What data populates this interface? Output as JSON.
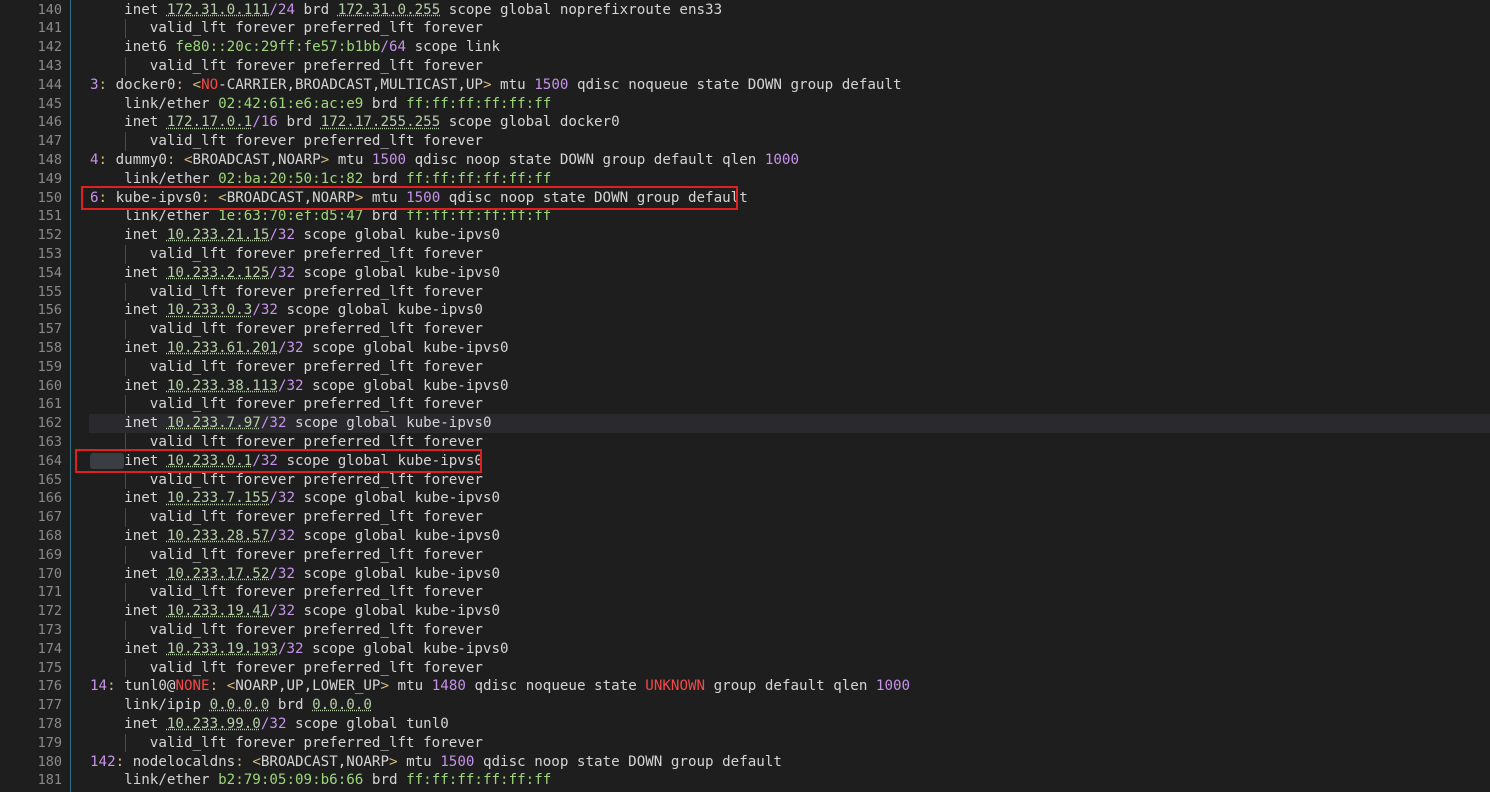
{
  "editor": {
    "line_numbers": [
      140,
      141,
      142,
      143,
      144,
      145,
      146,
      147,
      148,
      149,
      150,
      151,
      152,
      153,
      154,
      155,
      156,
      157,
      158,
      159,
      160,
      161,
      162,
      163,
      164,
      165,
      166,
      167,
      168,
      169,
      170,
      171,
      172,
      173,
      174,
      175,
      176,
      177,
      178,
      179,
      180,
      181
    ],
    "current_line": 162,
    "lines": [
      {
        "indent": 2,
        "tokens": [
          [
            "p",
            "inet "
          ],
          [
            "ip",
            "172.31.0.111"
          ],
          [
            "s",
            "/24"
          ],
          [
            "p",
            " brd "
          ],
          [
            "ip",
            "172.31.0.255"
          ],
          [
            "p",
            " scope global noprefixroute ens33"
          ]
        ]
      },
      {
        "indent": 3,
        "tokens": [
          [
            "p",
            "valid_lft forever preferred_lft forever"
          ]
        ]
      },
      {
        "indent": 2,
        "tokens": [
          [
            "p",
            "inet6 "
          ],
          [
            "mac",
            "fe80::20c:29ff:fe57:b1bb"
          ],
          [
            "s",
            "/64"
          ],
          [
            "p",
            " scope link"
          ]
        ]
      },
      {
        "indent": 3,
        "tokens": [
          [
            "p",
            "valid_lft forever preferred_lft forever"
          ]
        ]
      },
      {
        "indent": 0,
        "tokens": [
          [
            "idx",
            "3"
          ],
          [
            "c",
            ":"
          ],
          [
            "p",
            " docker0"
          ],
          [
            "c",
            ":"
          ],
          [
            "p",
            " "
          ],
          [
            "a",
            "<"
          ],
          [
            "r",
            "NO"
          ],
          [
            "p",
            "-CARRIER,BROADCAST,MULTICAST,UP"
          ],
          [
            "a",
            ">"
          ],
          [
            "p",
            " mtu "
          ],
          [
            "n",
            "1500"
          ],
          [
            "p",
            " qdisc noqueue state DOWN group default"
          ]
        ]
      },
      {
        "indent": 2,
        "tokens": [
          [
            "p",
            "link/ether "
          ],
          [
            "mac2",
            "02:42:61:e6:ac:e9"
          ],
          [
            "p",
            " brd "
          ],
          [
            "mac",
            "ff:ff:ff:ff:ff:ff"
          ]
        ]
      },
      {
        "indent": 2,
        "tokens": [
          [
            "p",
            "inet "
          ],
          [
            "ip",
            "172.17.0.1"
          ],
          [
            "s",
            "/16"
          ],
          [
            "p",
            " brd "
          ],
          [
            "ip",
            "172.17.255.255"
          ],
          [
            "p",
            " scope global docker0"
          ]
        ]
      },
      {
        "indent": 3,
        "tokens": [
          [
            "p",
            "valid_lft forever preferred_lft forever"
          ]
        ]
      },
      {
        "indent": 0,
        "tokens": [
          [
            "idx",
            "4"
          ],
          [
            "c",
            ":"
          ],
          [
            "p",
            " dummy0"
          ],
          [
            "c",
            ":"
          ],
          [
            "p",
            " "
          ],
          [
            "a",
            "<"
          ],
          [
            "p",
            "BROADCAST,NOARP"
          ],
          [
            "a",
            ">"
          ],
          [
            "p",
            " mtu "
          ],
          [
            "n",
            "1500"
          ],
          [
            "p",
            " qdisc noop state DOWN group default qlen "
          ],
          [
            "n",
            "1000"
          ]
        ]
      },
      {
        "indent": 2,
        "tokens": [
          [
            "p",
            "link/ether "
          ],
          [
            "mac",
            "02:ba:20:50:1c:82"
          ],
          [
            "p",
            " brd "
          ],
          [
            "mac",
            "ff:ff:ff:ff:ff:ff"
          ]
        ]
      },
      {
        "indent": 0,
        "tokens": [
          [
            "idx",
            "6"
          ],
          [
            "c",
            ":"
          ],
          [
            "p",
            " kube-ipvs0"
          ],
          [
            "c",
            ":"
          ],
          [
            "p",
            " "
          ],
          [
            "a",
            "<"
          ],
          [
            "p",
            "BROADCAST,NOARP"
          ],
          [
            "a",
            ">"
          ],
          [
            "p",
            " mtu "
          ],
          [
            "n",
            "1500"
          ],
          [
            "p",
            " qdisc noop state DOWN group default"
          ]
        ]
      },
      {
        "indent": 2,
        "tokens": [
          [
            "p",
            "link/ether "
          ],
          [
            "mac2",
            "1e:63:70:ef:d5:47"
          ],
          [
            "p",
            " brd "
          ],
          [
            "mac",
            "ff:ff:ff:ff:ff:ff"
          ]
        ]
      },
      {
        "indent": 2,
        "tokens": [
          [
            "p",
            "inet "
          ],
          [
            "ip",
            "10.233.21.15"
          ],
          [
            "s",
            "/32"
          ],
          [
            "p",
            " scope global kube-ipvs0"
          ]
        ]
      },
      {
        "indent": 3,
        "tokens": [
          [
            "p",
            "valid_lft forever preferred_lft forever"
          ]
        ]
      },
      {
        "indent": 2,
        "tokens": [
          [
            "p",
            "inet "
          ],
          [
            "ip",
            "10.233.2.125"
          ],
          [
            "s",
            "/32"
          ],
          [
            "p",
            " scope global kube-ipvs0"
          ]
        ]
      },
      {
        "indent": 3,
        "tokens": [
          [
            "p",
            "valid_lft forever preferred_lft forever"
          ]
        ]
      },
      {
        "indent": 2,
        "tokens": [
          [
            "p",
            "inet "
          ],
          [
            "ip",
            "10.233.0.3"
          ],
          [
            "s",
            "/32"
          ],
          [
            "p",
            " scope global kube-ipvs0"
          ]
        ]
      },
      {
        "indent": 3,
        "tokens": [
          [
            "p",
            "valid_lft forever preferred_lft forever"
          ]
        ]
      },
      {
        "indent": 2,
        "tokens": [
          [
            "p",
            "inet "
          ],
          [
            "ip",
            "10.233.61.201"
          ],
          [
            "s",
            "/32"
          ],
          [
            "p",
            " scope global kube-ipvs0"
          ]
        ]
      },
      {
        "indent": 3,
        "tokens": [
          [
            "p",
            "valid_lft forever preferred_lft forever"
          ]
        ]
      },
      {
        "indent": 2,
        "tokens": [
          [
            "p",
            "inet "
          ],
          [
            "ip",
            "10.233.38.113"
          ],
          [
            "s",
            "/32"
          ],
          [
            "p",
            " scope global kube-ipvs0"
          ]
        ]
      },
      {
        "indent": 3,
        "tokens": [
          [
            "p",
            "valid_lft forever preferred_lft forever"
          ]
        ]
      },
      {
        "indent": 2,
        "tokens": [
          [
            "p",
            "inet "
          ],
          [
            "ip",
            "10.233.7.97"
          ],
          [
            "s",
            "/32"
          ],
          [
            "p",
            " scope global kube-ipvs0"
          ]
        ]
      },
      {
        "indent": 3,
        "tokens": [
          [
            "p",
            "valid_lft forever preferred_lft forever"
          ]
        ]
      },
      {
        "indent": 2,
        "tokens": [
          [
            "p",
            "inet "
          ],
          [
            "ip",
            "10.233.0.1"
          ],
          [
            "s",
            "/32"
          ],
          [
            "p",
            " scope global kube-ipvs0"
          ]
        ],
        "selected": true
      },
      {
        "indent": 3,
        "tokens": [
          [
            "p",
            "valid_lft forever preferred_lft forever"
          ]
        ]
      },
      {
        "indent": 2,
        "tokens": [
          [
            "p",
            "inet "
          ],
          [
            "ip",
            "10.233.7.155"
          ],
          [
            "s",
            "/32"
          ],
          [
            "p",
            " scope global kube-ipvs0"
          ]
        ]
      },
      {
        "indent": 3,
        "tokens": [
          [
            "p",
            "valid_lft forever preferred_lft forever"
          ]
        ]
      },
      {
        "indent": 2,
        "tokens": [
          [
            "p",
            "inet "
          ],
          [
            "ip",
            "10.233.28.57"
          ],
          [
            "s",
            "/32"
          ],
          [
            "p",
            " scope global kube-ipvs0"
          ]
        ]
      },
      {
        "indent": 3,
        "tokens": [
          [
            "p",
            "valid_lft forever preferred_lft forever"
          ]
        ]
      },
      {
        "indent": 2,
        "tokens": [
          [
            "p",
            "inet "
          ],
          [
            "ip",
            "10.233.17.52"
          ],
          [
            "s",
            "/32"
          ],
          [
            "p",
            " scope global kube-ipvs0"
          ]
        ]
      },
      {
        "indent": 3,
        "tokens": [
          [
            "p",
            "valid_lft forever preferred_lft forever"
          ]
        ]
      },
      {
        "indent": 2,
        "tokens": [
          [
            "p",
            "inet "
          ],
          [
            "ip",
            "10.233.19.41"
          ],
          [
            "s",
            "/32"
          ],
          [
            "p",
            " scope global kube-ipvs0"
          ]
        ]
      },
      {
        "indent": 3,
        "tokens": [
          [
            "p",
            "valid_lft forever preferred_lft forever"
          ]
        ]
      },
      {
        "indent": 2,
        "tokens": [
          [
            "p",
            "inet "
          ],
          [
            "ip",
            "10.233.19.193"
          ],
          [
            "s",
            "/32"
          ],
          [
            "p",
            " scope global kube-ipvs0"
          ]
        ]
      },
      {
        "indent": 3,
        "tokens": [
          [
            "p",
            "valid_lft forever preferred_lft forever"
          ]
        ]
      },
      {
        "indent": 0,
        "tokens": [
          [
            "idx",
            "14"
          ],
          [
            "c",
            ":"
          ],
          [
            "p",
            " tunl0@"
          ],
          [
            "r",
            "NONE"
          ],
          [
            "c",
            ":"
          ],
          [
            "p",
            " "
          ],
          [
            "a",
            "<"
          ],
          [
            "p",
            "NOARP,UP,LOWER_UP"
          ],
          [
            "a",
            ">"
          ],
          [
            "p",
            " mtu "
          ],
          [
            "n",
            "1480"
          ],
          [
            "p",
            " qdisc noqueue state "
          ],
          [
            "r",
            "UNKNOWN"
          ],
          [
            "p",
            " group default qlen "
          ],
          [
            "n",
            "1000"
          ]
        ]
      },
      {
        "indent": 2,
        "tokens": [
          [
            "p",
            "link/ipip "
          ],
          [
            "ip",
            "0.0.0.0"
          ],
          [
            "p",
            " brd "
          ],
          [
            "ip",
            "0.0.0.0"
          ]
        ]
      },
      {
        "indent": 2,
        "tokens": [
          [
            "p",
            "inet "
          ],
          [
            "ip",
            "10.233.99.0"
          ],
          [
            "s",
            "/32"
          ],
          [
            "p",
            " scope global tunl0"
          ]
        ]
      },
      {
        "indent": 3,
        "tokens": [
          [
            "p",
            "valid_lft forever preferred_lft forever"
          ]
        ]
      },
      {
        "indent": 0,
        "tokens": [
          [
            "idx",
            "142"
          ],
          [
            "c",
            ":"
          ],
          [
            "p",
            " nodelocaldns"
          ],
          [
            "c",
            ":"
          ],
          [
            "p",
            " "
          ],
          [
            "a",
            "<"
          ],
          [
            "p",
            "BROADCAST,NOARP"
          ],
          [
            "a",
            ">"
          ],
          [
            "p",
            " mtu "
          ],
          [
            "n",
            "1500"
          ],
          [
            "p",
            " qdisc noop state DOWN group default"
          ]
        ]
      },
      {
        "indent": 2,
        "tokens": [
          [
            "p",
            "link/ether "
          ],
          [
            "mac2",
            "b2:79:05:09:b6:66"
          ],
          [
            "p",
            " brd "
          ],
          [
            "mac",
            "ff:ff:ff:ff:ff:ff"
          ]
        ]
      }
    ]
  },
  "annotations": [
    {
      "label": "kube-ipvs0-header-highlight",
      "line": 150
    },
    {
      "label": "inet-10-233-0-1-highlight",
      "line": 164
    }
  ],
  "colors": {
    "background": "#1e1e1e",
    "gutter_border": "#2f6f86",
    "line_number": "#8a8a8a",
    "number": "#c792ea",
    "ip": "#b5cea8",
    "mac": "#9cd67a",
    "error_red": "#f44747",
    "angle": "#d7ba7d",
    "highlight_box": "#e02020"
  }
}
